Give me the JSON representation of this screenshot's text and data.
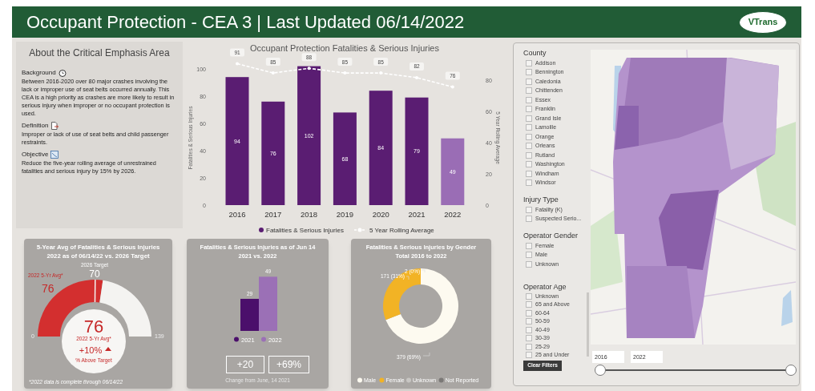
{
  "header": {
    "title": "Occupant Protection - CEA 3 | Last Updated 06/14/2022",
    "logo_text": "VTrans"
  },
  "about": {
    "title": "About the Critical Emphasis Area",
    "sections": [
      {
        "kind": "background",
        "heading": "Background",
        "text": "Between 2016-2020 over 80 major crashes involving the lack or improper use of seat belts occurred annually. This CEA is a high priority as crashes are more likely to result in serious injury when improper or no occupant protection is used."
      },
      {
        "kind": "definition",
        "heading": "Definition",
        "text": "Improper or lack of use of seat belts and child passenger restraints."
      },
      {
        "kind": "objective",
        "heading": "Objective",
        "text": "Reduce the five-year rolling average of unrestrained fatalities and serious injury by 15% by 2026."
      }
    ]
  },
  "main_chart": {
    "chart_data": {
      "type": "bar",
      "title": "Occupant Protection Fatalities & Serious Injuries",
      "categories": [
        "2016",
        "2017",
        "2018",
        "2019",
        "2020",
        "2021",
        "2022"
      ],
      "ylabel": "Fatalities & Serious Injuries",
      "y2label": "5 Year Rolling Average",
      "legend": "bottom",
      "ylim": [
        0,
        105
      ],
      "y2lim": [
        0,
        92
      ],
      "yticks": [
        0,
        20,
        40,
        60,
        80,
        100
      ],
      "y2ticks": [
        0,
        20,
        40,
        60,
        80
      ],
      "data_labels": true,
      "series": [
        {
          "name": "Fatalities & Serious Injuries",
          "type": "bar",
          "color": "#5a1d72",
          "colors": [
            "#5a1d72",
            "#5a1d72",
            "#5a1d72",
            "#5a1d72",
            "#5a1d72",
            "#5a1d72",
            "#9a6db5"
          ],
          "values": [
            94,
            76,
            102,
            68,
            84,
            79,
            49
          ]
        },
        {
          "name": "5 Year Rolling Average",
          "type": "line",
          "line_style": "dashed",
          "color": "#ffffff",
          "axis": "y2",
          "values": [
            91,
            85,
            88,
            85,
            85,
            82,
            76
          ]
        }
      ]
    }
  },
  "target_card": {
    "title_lines": [
      "5-Year Avg of Fatalities & Serious Injuries",
      "2022 as of 06/14/22 vs. 2026 Target"
    ],
    "target_label": "2026 Target",
    "target": "70",
    "avg_label": "2022 5-Yr Avg*",
    "avg": "76",
    "min": "0",
    "max": "139",
    "center_value": "76",
    "center_label": "2022 5-Yr Avg*",
    "change": "+10%",
    "change_label": "% Above Target",
    "footnote": "*2022 data is complete through 06/14/22"
  },
  "ytd_card": {
    "title_lines": [
      "Fatalities & Serious Injuries as of Jun 14",
      "2021 vs. 2022"
    ],
    "chart_data": {
      "type": "bar",
      "categories": [
        "2021",
        "2022"
      ],
      "data_labels": true,
      "series": [
        {
          "values": [
            29,
            49
          ]
        }
      ]
    },
    "legend": [
      {
        "label": "2021",
        "color": "#4b0f6b"
      },
      {
        "label": "2022",
        "color": "#9b70b6"
      }
    ],
    "change_count": "+20",
    "change_pct": "+69%",
    "caption": "Change from June, 14 2021"
  },
  "gender_card": {
    "title_lines": [
      "Fatalities & Serious Injuries by Gender",
      "Total 2016 to 2022"
    ],
    "chart_data": {
      "type": "donut",
      "legend": "bottom",
      "categories": [
        "Male",
        "Female",
        "Unknown",
        "Not Reported"
      ],
      "series": [
        {
          "colors": [
            "#fdfaf0",
            "#f2b325",
            "#c8c6c3",
            "#7a7876"
          ],
          "values": [
            69,
            31,
            0,
            0
          ]
        }
      ],
      "value_labels": [
        "379 (69%)",
        "171 (31%)",
        "2 (0%)",
        null
      ]
    }
  },
  "filters": [
    {
      "title": "County",
      "items": [
        {
          "label": "Addison",
          "checked": false
        },
        {
          "label": "Bennington",
          "checked": false
        },
        {
          "label": "Caledonia",
          "checked": false
        },
        {
          "label": "Chittenden",
          "checked": false
        },
        {
          "label": "Essex",
          "checked": false
        },
        {
          "label": "Franklin",
          "checked": false
        },
        {
          "label": "Grand Isle",
          "checked": false
        },
        {
          "label": "Lamoille",
          "checked": false
        },
        {
          "label": "Orange",
          "checked": false
        },
        {
          "label": "Orleans",
          "checked": false
        },
        {
          "label": "Rutland",
          "checked": false
        },
        {
          "label": "Washington",
          "checked": false
        },
        {
          "label": "Windham",
          "checked": false
        },
        {
          "label": "Windsor",
          "checked": false
        }
      ]
    },
    {
      "title": "Injury Type",
      "items": [
        {
          "label": "Fatality (K)",
          "checked": false
        },
        {
          "label": "Suspected Serio...",
          "checked": false
        }
      ]
    },
    {
      "title": "Operator Gender",
      "items": [
        {
          "label": "Female",
          "checked": false
        },
        {
          "label": "Male",
          "checked": false
        },
        {
          "label": "Unknown",
          "checked": false
        }
      ]
    },
    {
      "title": "Operator Age",
      "items": [
        {
          "label": "Unknown",
          "checked": false
        },
        {
          "label": "65 and Above",
          "checked": false
        },
        {
          "label": "60-64",
          "checked": false
        },
        {
          "label": "50-59",
          "checked": false
        },
        {
          "label": "40-49",
          "checked": false
        },
        {
          "label": "30-39",
          "checked": false
        },
        {
          "label": "25-29",
          "checked": false
        },
        {
          "label": "25 and Under",
          "checked": false
        }
      ]
    }
  ],
  "clear_button": "Clear Filters",
  "year_range": {
    "from": "2016",
    "to": "2022"
  }
}
